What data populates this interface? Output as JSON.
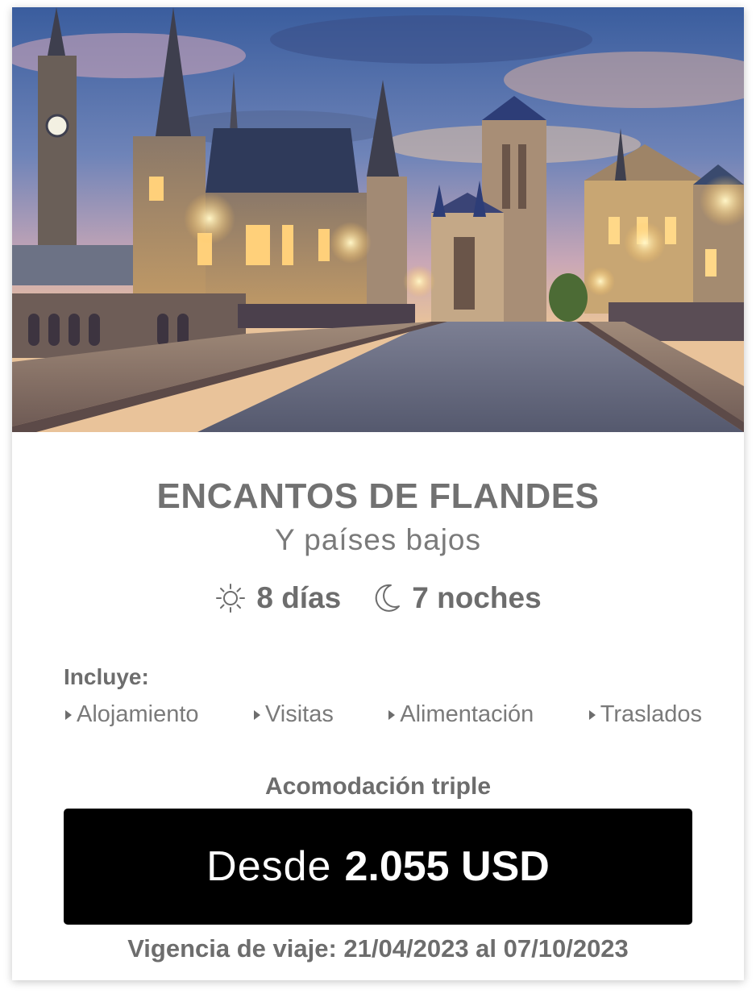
{
  "hero": {
    "alt_icon": "gent-cityscape-photo"
  },
  "tour": {
    "title": "ENCANTOS DE FLANDES",
    "subtitle": "Y países bajos",
    "days": "8 días",
    "nights": "7 noches"
  },
  "includes": {
    "label": "Incluye:",
    "items": [
      "Alojamiento",
      "Visitas",
      "Alimentación",
      "Traslados"
    ]
  },
  "pricing": {
    "accommodation": "Acomodación triple",
    "prefix": "Desde",
    "amount": "2.055 USD"
  },
  "validity": "Vigencia de viaje: 21/04/2023 al 07/10/2023",
  "colors": {
    "text_gray": "#717171",
    "button_bg": "#000000",
    "button_text": "#ffffff"
  }
}
